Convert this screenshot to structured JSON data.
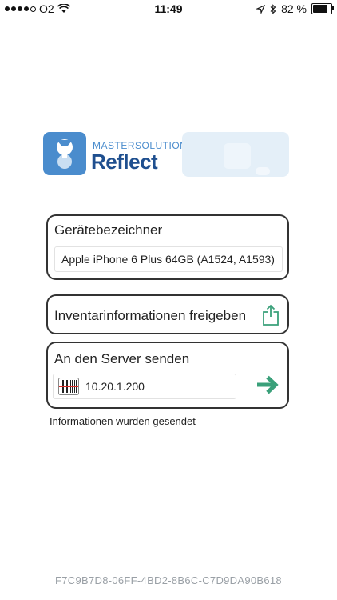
{
  "status_bar": {
    "carrier": "O2",
    "time": "11:49",
    "battery": "82 %",
    "battery_level": 0.82,
    "signal_bars_filled": 4,
    "signal_bars_total": 5,
    "icons": [
      "wifi-icon",
      "location-arrow-icon",
      "bluetooth-icon",
      "battery-icon"
    ]
  },
  "logo": {
    "line1": "MASTERSOLUTION",
    "line2": "Reflect",
    "colors": {
      "icon_bg": "#4a8ccd",
      "text_top": "#4a8ccd",
      "text_main": "#1f4f8f",
      "graphic_bg": "#e4eff8"
    }
  },
  "device_card": {
    "title": "Gerätebezeichner",
    "value": "Apple iPhone 6 Plus 64GB (A1524, A1593)"
  },
  "inventory_card": {
    "label": "Inventarinformationen freigeben",
    "icon": "share-icon"
  },
  "server_card": {
    "title": "An den Server senden",
    "server_address": "10.20.1.200",
    "icons": [
      "barcode-icon",
      "arrow-right-icon"
    ],
    "accent": "#3aa07a"
  },
  "status_message": "Informationen wurden gesendet",
  "device_id": "F7C9B7D8-06FF-4BD2-8B6C-C7D9DA90B618"
}
